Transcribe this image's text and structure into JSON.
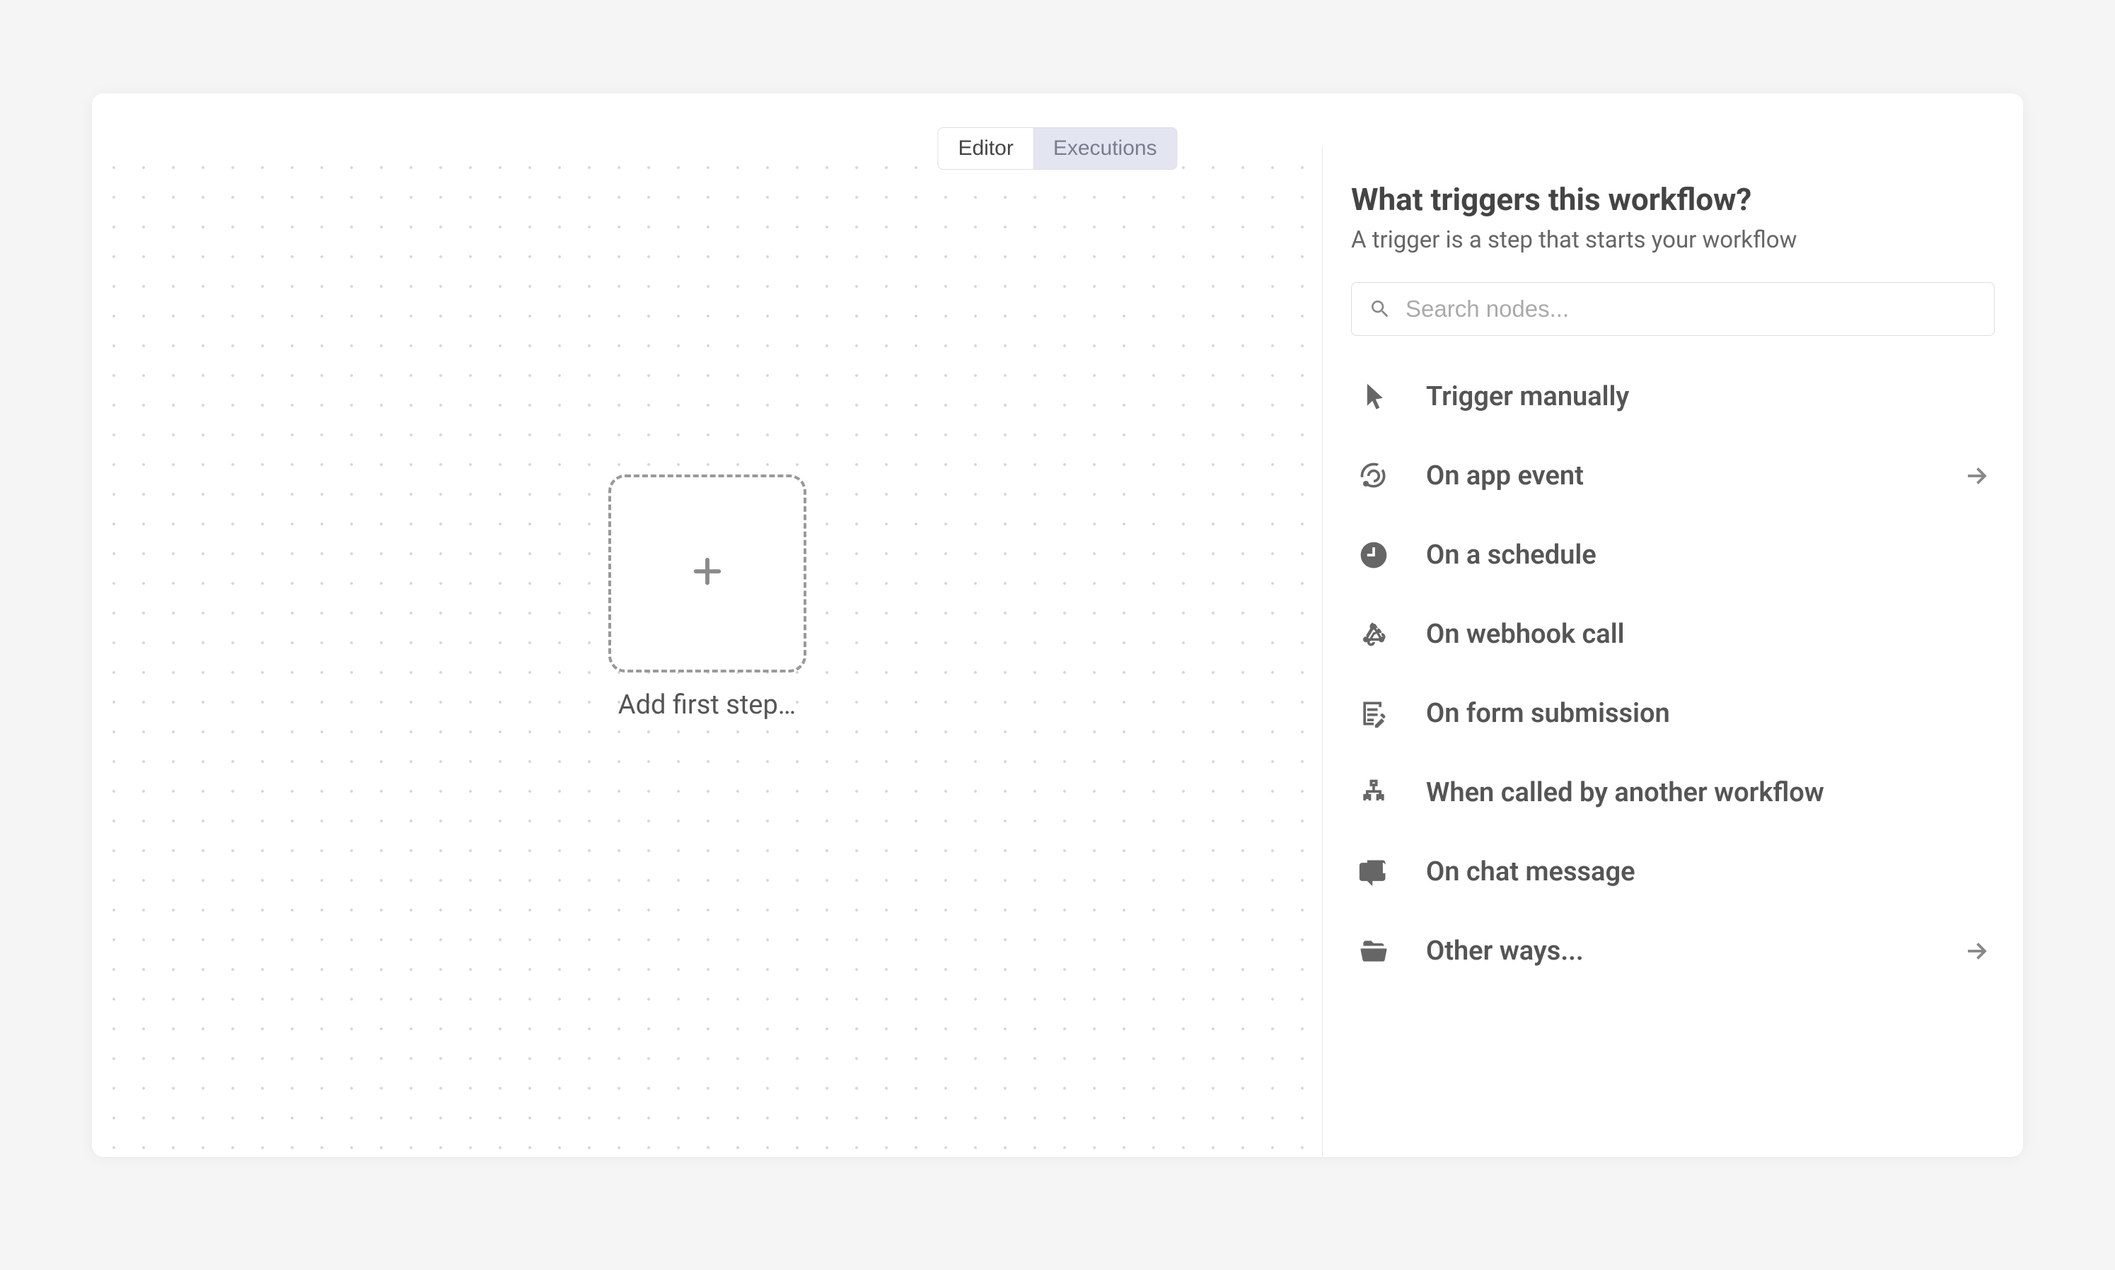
{
  "tabs": {
    "editor": "Editor",
    "executions": "Executions"
  },
  "canvas": {
    "add_first_step_label": "Add first step…"
  },
  "panel": {
    "title": "What triggers this workflow?",
    "subtitle": "A trigger is a step that starts your workflow",
    "search_placeholder": "Search nodes..."
  },
  "triggers": [
    {
      "label": "Trigger manually",
      "icon": "cursor",
      "has_arrow": false
    },
    {
      "label": "On app event",
      "icon": "rss",
      "has_arrow": true
    },
    {
      "label": "On a schedule",
      "icon": "clock",
      "has_arrow": false
    },
    {
      "label": "On webhook call",
      "icon": "webhook",
      "has_arrow": false
    },
    {
      "label": "On form submission",
      "icon": "form",
      "has_arrow": false
    },
    {
      "label": "When called by another workflow",
      "icon": "sitemap",
      "has_arrow": false
    },
    {
      "label": "On chat message",
      "icon": "chat",
      "has_arrow": false
    },
    {
      "label": "Other ways...",
      "icon": "folder",
      "has_arrow": true
    }
  ]
}
